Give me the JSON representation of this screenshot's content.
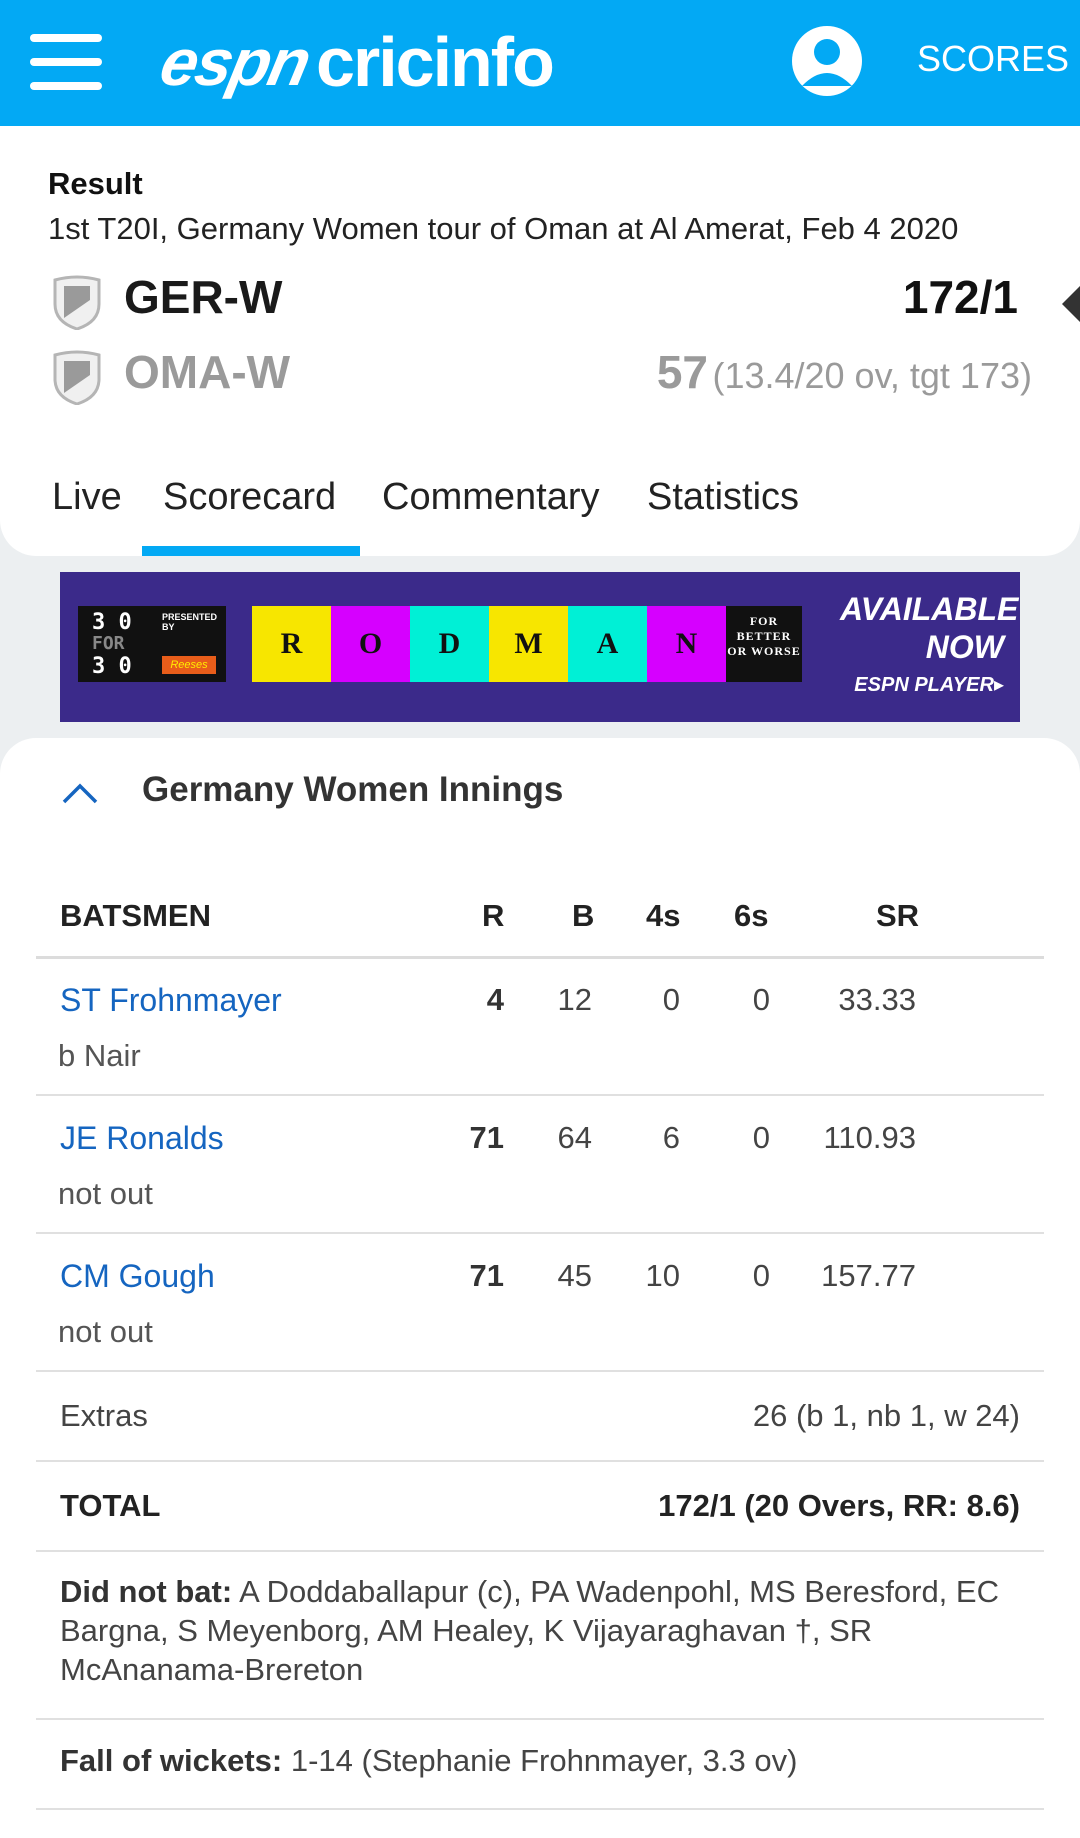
{
  "header": {
    "logo_espn": "espn",
    "logo_cricinfo": "cricinfo",
    "scores_label": "SCORES",
    "brand_color": "#03a9f4"
  },
  "match": {
    "status": "Result",
    "description": "1st T20I, Germany Women tour of Oman at Al Amerat, Feb 4 2020",
    "team1": {
      "name": "GER-W",
      "score": "172/1"
    },
    "team2": {
      "name": "OMA-W",
      "score": "57",
      "detail": "(13.4/20 ov, tgt 173)"
    }
  },
  "tabs": [
    {
      "label": "Live"
    },
    {
      "label": "Scorecard",
      "active": true
    },
    {
      "label": "Commentary"
    },
    {
      "label": "Statistics"
    }
  ],
  "ad": {
    "series_top": "3 0",
    "series_mid": "FOR",
    "series_bot": "3 0",
    "presented_by": "PRESENTED BY",
    "sponsor": "Reeses",
    "letters": [
      "R",
      "O",
      "D",
      "M",
      "A",
      "N"
    ],
    "letter_colors": [
      "#f7e600",
      "#d600ff",
      "#00f0d6",
      "#f7e600",
      "#00f0d6",
      "#d600ff"
    ],
    "tagline": "FOR BETTER OR WORSE",
    "available_line1": "AVAILABLE",
    "available_line2": "NOW",
    "player": "ESPN PLAYER▸"
  },
  "innings": {
    "title": "Germany Women Innings",
    "columns": [
      "BATSMEN",
      "R",
      "B",
      "4s",
      "6s",
      "SR"
    ],
    "batsmen": [
      {
        "name": "ST Frohnmayer",
        "dismissal": "b Nair",
        "r": "4",
        "b": "12",
        "fours": "0",
        "sixes": "0",
        "sr": "33.33"
      },
      {
        "name": "JE Ronalds",
        "dismissal": "not out",
        "r": "71",
        "b": "64",
        "fours": "6",
        "sixes": "0",
        "sr": "110.93"
      },
      {
        "name": "CM Gough",
        "dismissal": "not out",
        "r": "71",
        "b": "45",
        "fours": "10",
        "sixes": "0",
        "sr": "157.77"
      }
    ],
    "extras_label": "Extras",
    "extras_value": "26 (b 1, nb 1, w 24)",
    "total_label": "TOTAL",
    "total_value": "172/1 (20 Overs, RR: 8.6)",
    "did_not_bat_label": "Did not bat:",
    "did_not_bat": " A Doddaballapur (c), PA Wadenpohl, MS Beresford, EC Bargna, S Meyenborg, AM Healey, K Vijayaraghavan †, SR McAnanama-Brereton",
    "fow_label": "Fall of wickets:",
    "fow": " 1-14 (Stephanie Frohnmayer, 3.3 ov)"
  }
}
